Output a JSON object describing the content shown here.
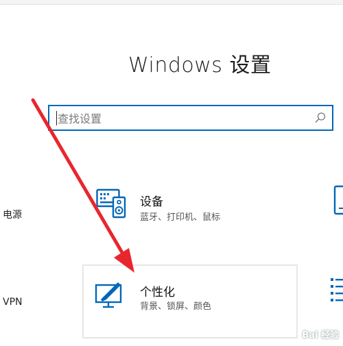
{
  "header": {
    "title": "Windows 设置"
  },
  "search": {
    "placeholder": "查找设置",
    "icon": "search-icon"
  },
  "left_partial": [
    {
      "label": "电源"
    },
    {
      "label": "VPN"
    }
  ],
  "tiles": {
    "devices": {
      "title": "设备",
      "description": "蓝牙、打印机、鼠标",
      "icon": "devices-icon"
    },
    "personalization": {
      "title": "个性化",
      "description": "背景、锁屏、颜色",
      "icon": "personalization-icon"
    }
  },
  "colors": {
    "accent": "#0067b8",
    "annotation_arrow": "#e8262e",
    "tile_border": "#e6e6e6"
  },
  "watermark": {
    "text": "Bai 经验"
  }
}
